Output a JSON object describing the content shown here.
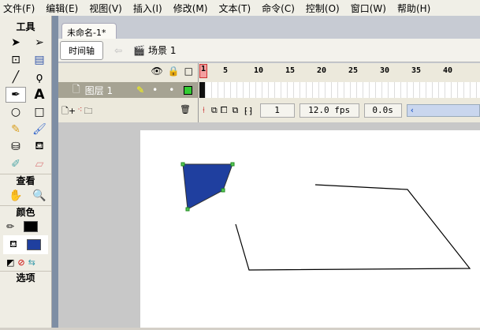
{
  "menu": [
    "文件(F)",
    "编辑(E)",
    "视图(V)",
    "插入(I)",
    "修改(M)",
    "文本(T)",
    "命令(C)",
    "控制(O)",
    "窗口(W)",
    "帮助(H)"
  ],
  "tools": {
    "title": "工具",
    "view_title": "查看",
    "color_title": "颜色",
    "options_title": "选项"
  },
  "document": {
    "tab": "未命名-1*",
    "timeline_button": "时间轴",
    "scene": "场景 1"
  },
  "timeline": {
    "ruler": [
      "1",
      "5",
      "10",
      "15",
      "20",
      "25",
      "30",
      "35",
      "40"
    ],
    "layer_name": "图层 1",
    "current_frame": "1",
    "fps": "12.0 fps",
    "time": "0.0s"
  },
  "colors": {
    "stroke": "#000000",
    "fill": "#1f3f9f",
    "layer_outline": "#33cc33"
  }
}
